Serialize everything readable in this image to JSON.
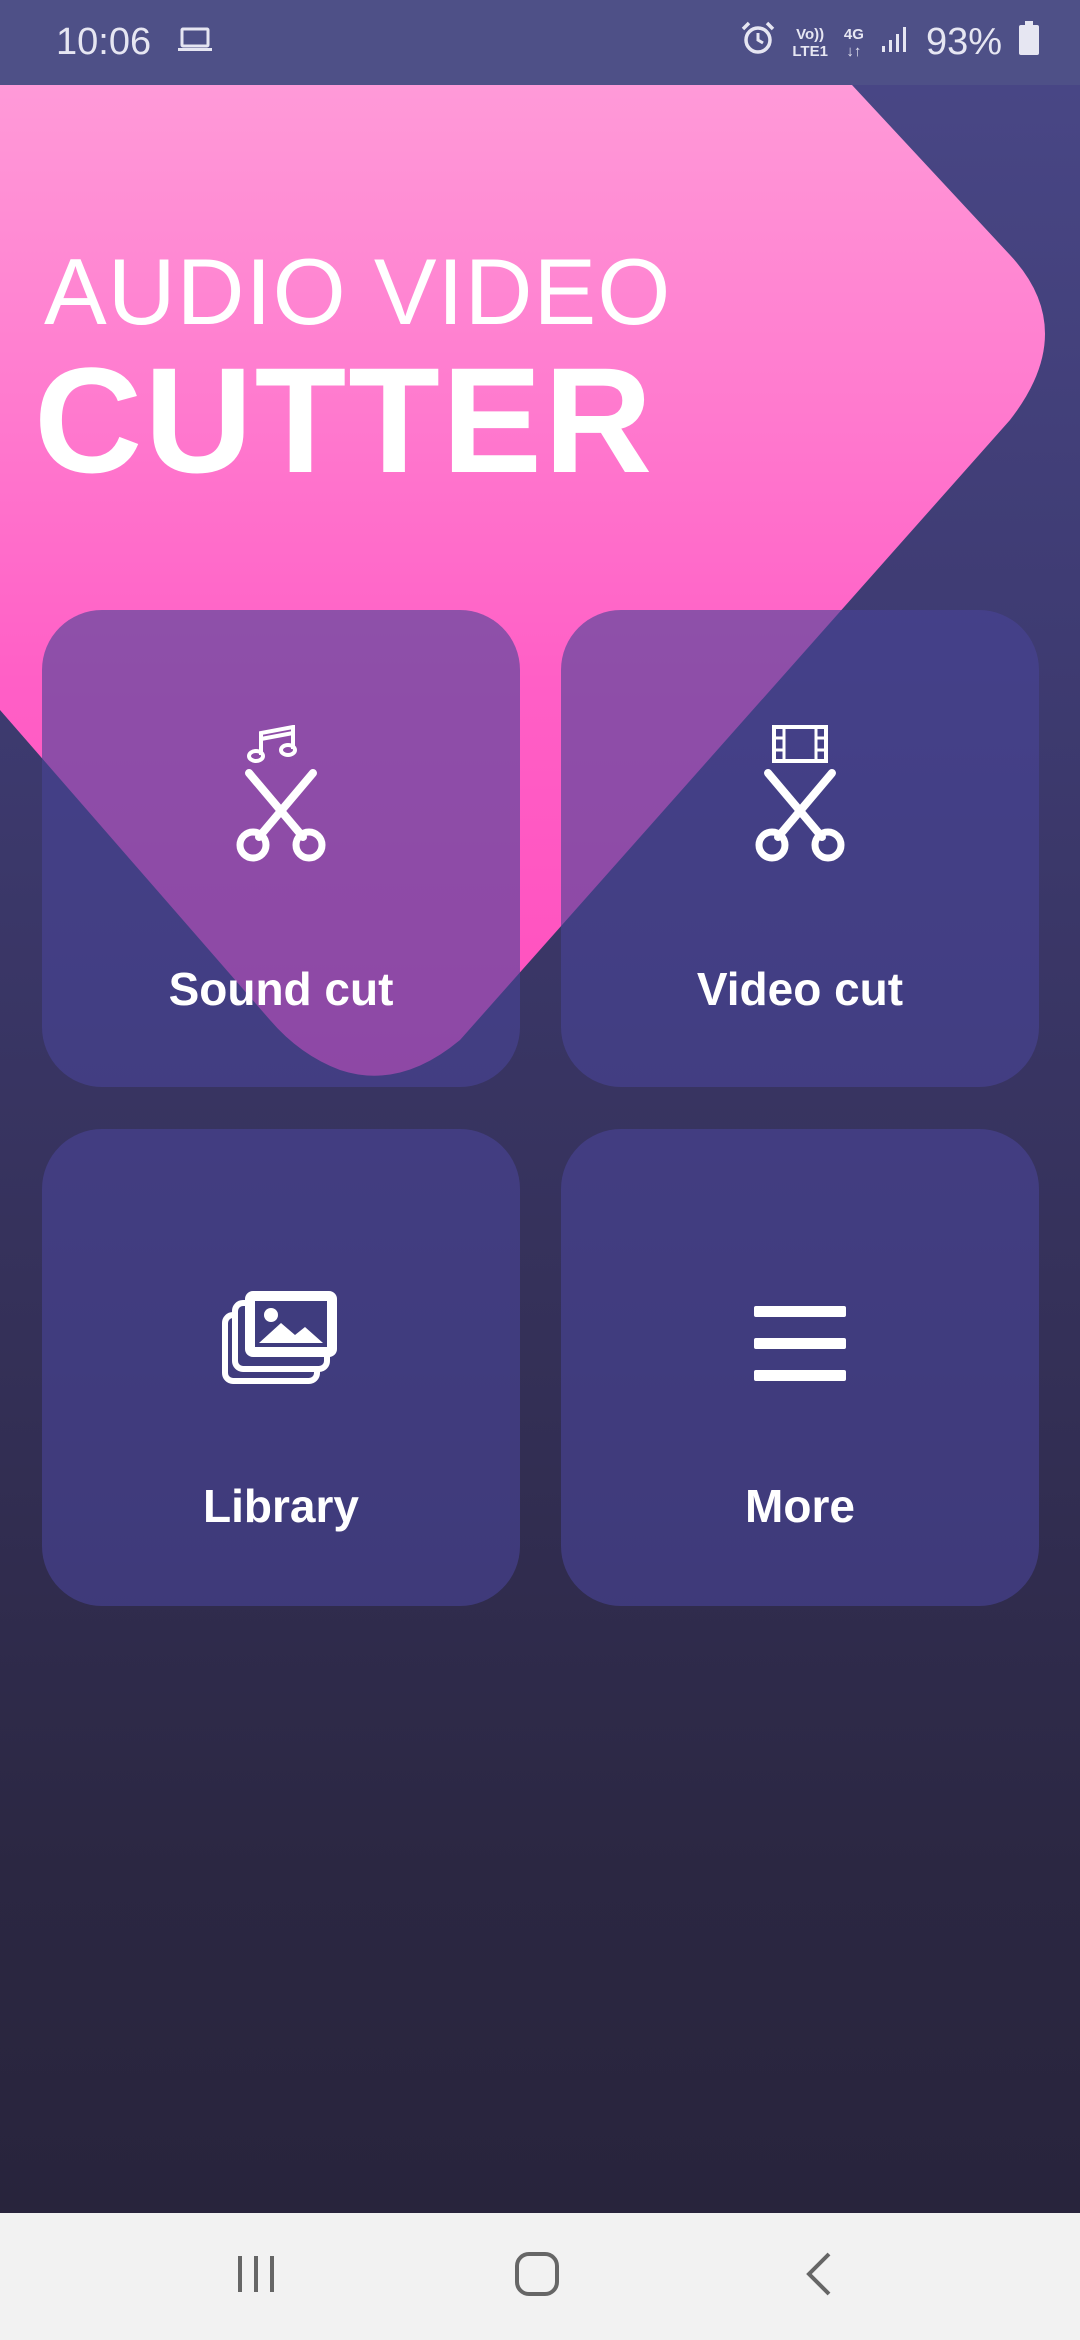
{
  "status_bar": {
    "time": "10:06",
    "volte_top": "Vo))",
    "volte_bottom": "LTE1",
    "network_top": "4G",
    "network_bottom": "↓↑",
    "battery": "93%",
    "icons": [
      "laptop-icon",
      "alarm-icon",
      "signal-icon",
      "battery-icon"
    ]
  },
  "header": {
    "line1": "AUDIO VIDEO",
    "line2": "CUTTER"
  },
  "tiles": [
    {
      "label": "Sound cut",
      "icon": "music-scissors-icon"
    },
    {
      "label": "Video cut",
      "icon": "film-scissors-icon"
    },
    {
      "label": "Library",
      "icon": "gallery-icon"
    },
    {
      "label": "More",
      "icon": "menu-icon"
    }
  ],
  "colors": {
    "status_bar": "#4e5087",
    "pink_top": "#ff9ad8",
    "pink_bottom": "#ff5ac3",
    "tile": "#484496",
    "nav_bar": "#f2f2f2"
  },
  "nav_bar": {
    "icons": [
      "recents-icon",
      "home-icon",
      "back-icon"
    ]
  }
}
